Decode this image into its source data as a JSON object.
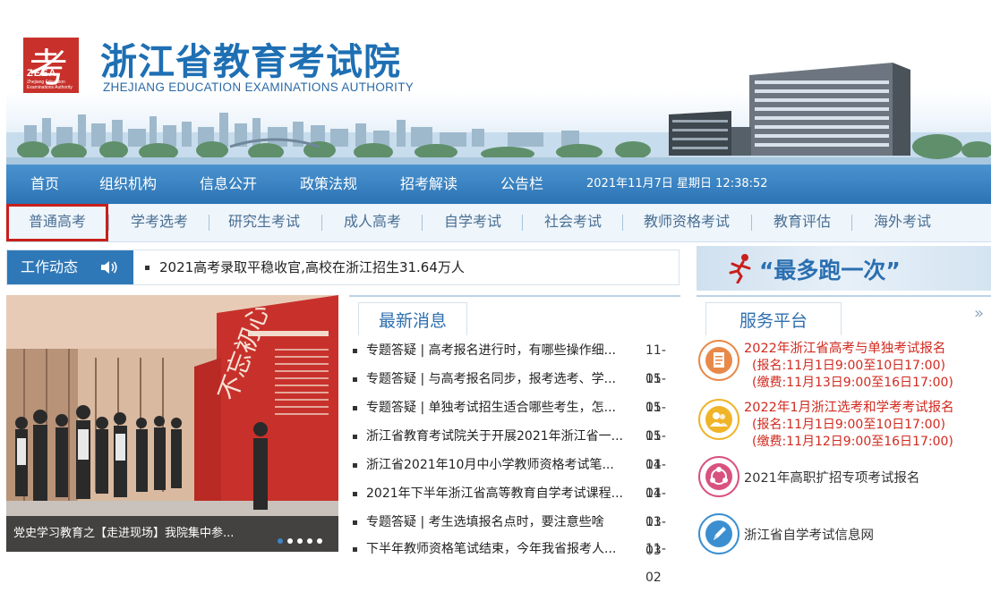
{
  "header": {
    "logo_glyph": "考",
    "logo_abbr": "ZEEA",
    "logo_small_1": "Zhejiang Education",
    "logo_small_2": "Examinations Authority",
    "title": "浙江省教育考试院",
    "subtitle": "ZHEJIANG EDUCATION EXAMINATIONS AUTHORITY"
  },
  "nav_main": {
    "items": [
      "首页",
      "组织机构",
      "信息公开",
      "政策法规",
      "招考解读",
      "公告栏"
    ],
    "datetime": "2021年11月7日 星期日 12:38:52"
  },
  "nav_exams": {
    "items": [
      "普通高考",
      "学考选考",
      "研究生考试",
      "成人高考",
      "自学考试",
      "社会考试",
      "教师资格考试",
      "教育评估",
      "海外考试"
    ]
  },
  "ticker": {
    "label": "工作动态",
    "text": "2021高考录取平稳收官,高校在浙江招生31.64万人"
  },
  "banner": {
    "slogan": "“最多跑一次”"
  },
  "featured": {
    "caption": "党史学习教育之【走进现场】我院集中参...",
    "slide_count": 5,
    "active_slide": 1
  },
  "latest": {
    "heading": "最新消息",
    "items": [
      {
        "title": "专题答疑 | 高考报名进行时，有哪些操作细...",
        "date": "11-05"
      },
      {
        "title": "专题答疑 | 与高考报名同步，报考选考、学...",
        "date": "11-05"
      },
      {
        "title": "专题答疑 | 单独考试招生适合哪些考生，怎...",
        "date": "11-05"
      },
      {
        "title": "浙江省教育考试院关于开展2021年浙江省一...",
        "date": "11-04"
      },
      {
        "title": "浙江省2021年10月中小学教师资格考试笔...",
        "date": "11-04"
      },
      {
        "title": "2021年下半年浙江省高等教育自学考试课程...",
        "date": "11-03"
      },
      {
        "title": "专题答疑 | 考生选填报名点时，要注意些啥",
        "date": "11-03"
      },
      {
        "title": "下半年教师资格笔试结束，今年我省报考人...",
        "date": "11-02"
      }
    ]
  },
  "service": {
    "heading": "服务平台",
    "more": "»",
    "items": [
      {
        "icon": "document-icon",
        "color": "#e8894a",
        "title": "2022年浙江省高考与单独考试报名",
        "line2": "(报名:11月1日9:00至10日17:00)",
        "line3": "(缴费:11月13日9:00至16日17:00)"
      },
      {
        "icon": "users-icon",
        "color": "#f0b429",
        "title": "2022年1月浙江选考和学考考试报名",
        "line2": "(报名:11月1日9:00至10日17:00)",
        "line3": "(缴费:11月12日9:00至16日17:00)"
      },
      {
        "icon": "share-icon",
        "color": "#d9527f",
        "title": "2021年高职扩招专项考试报名",
        "line2": "",
        "line3": ""
      },
      {
        "icon": "pen-icon",
        "color": "#3b8fd0",
        "title": "浙江省自学考试信息网",
        "line2": "",
        "line3": ""
      }
    ]
  }
}
